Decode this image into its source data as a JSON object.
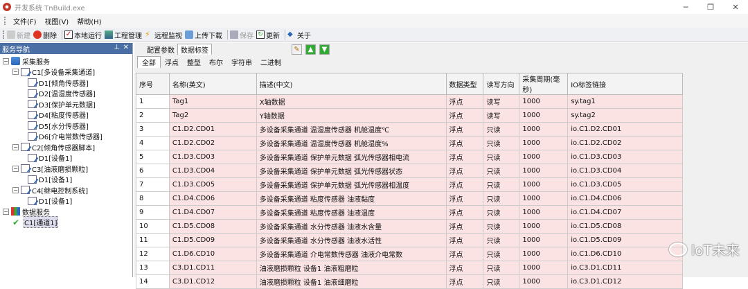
{
  "window": {
    "title": "开发系统 TnBuild.exe"
  },
  "menu": [
    "文件(F)",
    "视图(V)",
    "帮助(H)"
  ],
  "toolbar": {
    "new": "新建",
    "delete": "删除",
    "run": "本地运行",
    "project": "工程管理",
    "monitor": "远程监视",
    "upload": "上传下载",
    "save": "保存",
    "update": "更新",
    "about": "关于"
  },
  "nav": {
    "title": "服务导航",
    "tree": [
      {
        "label": "采集服务",
        "level": 0,
        "icon": "folder-icon"
      },
      {
        "label": "C1[多设备采集通道]",
        "level": 1,
        "icon": "channel-icon"
      },
      {
        "label": "D1[倾角传感器]",
        "level": 2,
        "icon": "device-icon"
      },
      {
        "label": "D2[温湿度传感器]",
        "level": 2,
        "icon": "device-icon"
      },
      {
        "label": "D3[保护单元数据]",
        "level": 2,
        "icon": "device-icon"
      },
      {
        "label": "D4[粘度传感器]",
        "level": 2,
        "icon": "device-icon"
      },
      {
        "label": "D5[水分传感器]",
        "level": 2,
        "icon": "device-icon"
      },
      {
        "label": "D6[介电常数传感器]",
        "level": 2,
        "icon": "device-icon"
      },
      {
        "label": "C2[倾角传感器脚本]",
        "level": 1,
        "icon": "channel-icon"
      },
      {
        "label": "D1[设备1]",
        "level": 2,
        "icon": "device-icon"
      },
      {
        "label": "C3[油液磨损颗粒]",
        "level": 1,
        "icon": "channel-icon"
      },
      {
        "label": "D1[设备1]",
        "level": 2,
        "icon": "device-icon"
      },
      {
        "label": "C4[继电控制系统]",
        "level": 1,
        "icon": "channel-icon"
      },
      {
        "label": "D1[设备1]",
        "level": 2,
        "icon": "device-icon"
      },
      {
        "label": "数据服务",
        "level": 0,
        "icon": "database-icon"
      },
      {
        "label": "C1[通道1]",
        "level": 1,
        "icon": "check-icon"
      }
    ]
  },
  "tabs_top": [
    "配置参数",
    "数据标签"
  ],
  "tabs_filter": [
    "全部",
    "浮点",
    "整型",
    "布尔",
    "字符串",
    "二进制"
  ],
  "table": {
    "headers": [
      "序号",
      "名称(英文)",
      "描述(中文)",
      "数据类型",
      "读写方向",
      "采集周期(毫秒)",
      "IO标签链接"
    ],
    "rows": [
      [
        "1",
        "Tag1",
        "X轴数据",
        "浮点",
        "读写",
        "1000",
        "sy.tag1"
      ],
      [
        "2",
        "Tag2",
        "Y轴数据",
        "浮点",
        "读写",
        "1000",
        "sy.tag2"
      ],
      [
        "3",
        "C1.D2.CD01",
        "多设备采集通道 温湿度传感器 机舱温度℃",
        "浮点",
        "只读",
        "1000",
        "io.C1.D2.CD01"
      ],
      [
        "4",
        "C1.D2.CD02",
        "多设备采集通道 温湿度传感器 机舱湿度%",
        "浮点",
        "只读",
        "1000",
        "io.C1.D2.CD02"
      ],
      [
        "5",
        "C1.D3.CD03",
        "多设备采集通道 保护单元数据 弧光传感器相电流",
        "浮点",
        "只读",
        "1000",
        "io.C1.D3.CD03"
      ],
      [
        "6",
        "C1.D3.CD04",
        "多设备采集通道 保护单元数据 弧光传感器状态",
        "浮点",
        "只读",
        "1000",
        "io.C1.D3.CD04"
      ],
      [
        "7",
        "C1.D3.CD05",
        "多设备采集通道 保护单元数据 弧光传感器相温度",
        "浮点",
        "只读",
        "1000",
        "io.C1.D3.CD05"
      ],
      [
        "8",
        "C1.D4.CD06",
        "多设备采集通道 粘度传感器 油液黏度",
        "浮点",
        "只读",
        "1000",
        "io.C1.D4.CD06"
      ],
      [
        "9",
        "C1.D4.CD07",
        "多设备采集通道 粘度传感器 油液温度",
        "浮点",
        "只读",
        "1000",
        "io.C1.D4.CD07"
      ],
      [
        "10",
        "C1.D5.CD08",
        "多设备采集通道 水分传感器 油液水含量",
        "浮点",
        "只读",
        "1000",
        "io.C1.D5.CD08"
      ],
      [
        "11",
        "C1.D5.CD09",
        "多设备采集通道 水分传感器 油液水活性",
        "浮点",
        "只读",
        "1000",
        "io.C1.D5.CD09"
      ],
      [
        "12",
        "C1.D6.CD10",
        "多设备采集通道 介电常数传感器 油液介电常数",
        "浮点",
        "只读",
        "1000",
        "io.C1.D6.CD10"
      ],
      [
        "13",
        "C3.D1.CD11",
        "油液磨损颗粒 设备1 油液粗磨粒",
        "浮点",
        "只读",
        "1000",
        "io.C3.D1.CD11"
      ],
      [
        "14",
        "C3.D1.CD12",
        "油液磨损颗粒 设备1 油液细磨粒",
        "浮点",
        "只读",
        "1000",
        "io.C3.D1.CD12"
      ]
    ]
  },
  "watermark": "IoT未来"
}
